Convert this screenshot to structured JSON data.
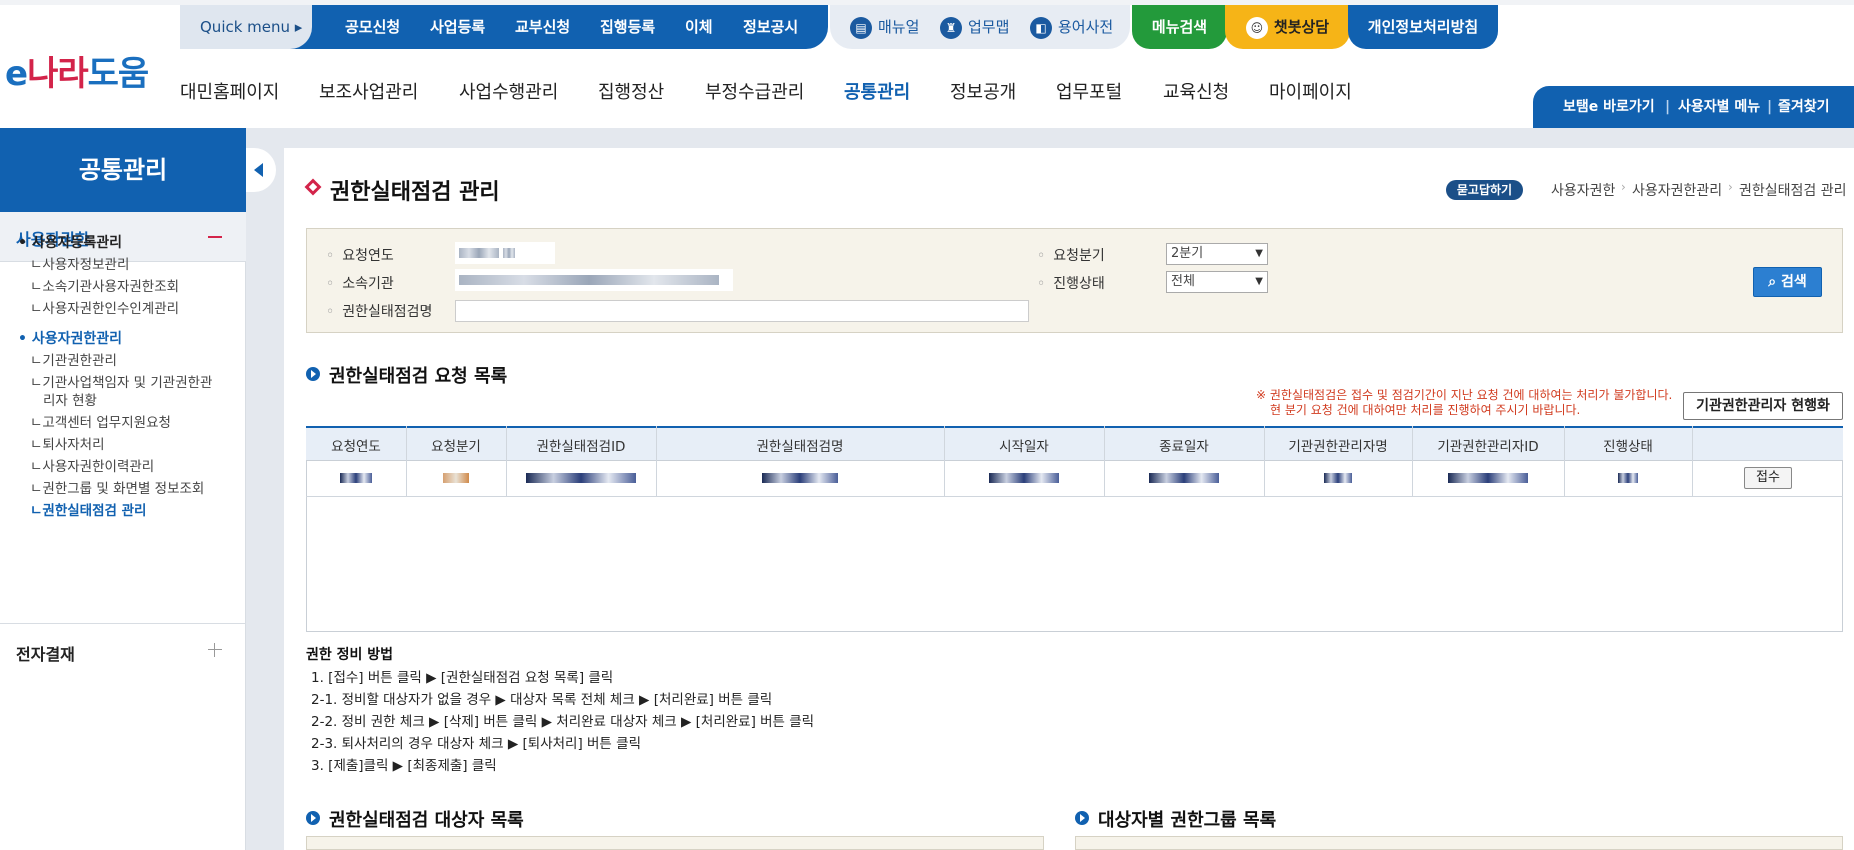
{
  "header": {
    "logo": {
      "e": "e",
      "nara": "나라",
      "doum": "도움"
    },
    "quick_menu": "Quick menu ▸",
    "quick_links": [
      "공모신청",
      "사업등록",
      "교부신청",
      "집행등록",
      "이체",
      "정보공시"
    ],
    "util_links": [
      {
        "icon": "book-icon",
        "glyph": "▤",
        "label": "매뉴얼"
      },
      {
        "icon": "user-map-icon",
        "glyph": "♜",
        "label": "업무맵"
      },
      {
        "icon": "dictionary-icon",
        "glyph": "◧",
        "label": "용어사전"
      }
    ],
    "menu_search": "메뉴검색",
    "chatbot": "챗봇상담",
    "privacy": "개인정보처리방침",
    "gnb": [
      "대민홈페이지",
      "보조사업관리",
      "사업수행관리",
      "집행정산",
      "부정수급관리",
      "공통관리",
      "정보공개",
      "업무포털",
      "교육신청",
      "마이페이지"
    ],
    "gnb_active_index": 5,
    "shortcuts": [
      "보탬e 바로가기",
      "사용자별 메뉴",
      "즐겨찾기"
    ]
  },
  "sidebar": {
    "title": "공통관리",
    "section": "사용자권한",
    "groups": [
      {
        "label": "사용자등록관리",
        "items": [
          "ㄴ사용자정보관리",
          "ㄴ소속기관사용자권한조회",
          "ㄴ사용자권한인수인계관리"
        ]
      },
      {
        "label": "사용자권한관리",
        "items": [
          "ㄴ기관권한관리",
          "ㄴ기관사업책임자 및 기관권한관",
          "리자 현황",
          "ㄴ고객센터 업무지원요청",
          "ㄴ퇴사자처리",
          "ㄴ사용자권한이력관리",
          "ㄴ권한그룹 및 화면별 정보조회",
          "ㄴ권한실태점검 관리"
        ]
      }
    ],
    "section2": "전자결재"
  },
  "main": {
    "title": "권한실태점검 관리",
    "qa_badge": "묻고답하기",
    "breadcrumb": [
      "사용자권한",
      "사용자권한관리",
      "권한실태점검 관리"
    ],
    "search": {
      "year_label": "요청연도",
      "org_label": "소속기관",
      "name_label": "권한실태점검명",
      "quarter_label": "요청분기",
      "quarter_value": "2분기",
      "status_label": "진행상태",
      "status_value": "전체",
      "search_button": "검색"
    },
    "list_title": "권한실태점검 요청 목록",
    "notice": [
      "※ 권한실태점검은 접수 및 점검기간이 지난 요청 건에 대하여는 처리가 불가합니다.",
      "현 분기 요청 건에 대하여만 처리를 진행하여 주시기 바랍니다."
    ],
    "manager_button": "기관권한관리자 현행화",
    "table": {
      "headers": [
        "요청연도",
        "요청분기",
        "권한실태점검ID",
        "권한실태점검명",
        "시작일자",
        "종료일자",
        "기관권한관리자명",
        "기관권한관리자ID",
        "진행상태",
        ""
      ],
      "accept_button": "접수"
    },
    "guide": {
      "title": "권한 정비 방법",
      "lines": [
        "1. [접수] 버튼 클릭 ▶ [권한실태점검 요청 목록] 클릭",
        "2-1. 정비할 대상자가 없을 경우 ▶ 대상자 목록 전체 체크 ▶ [처리완료] 버튼 클릭",
        "2-2. 정비 권한 체크 ▶ [삭제] 버튼 클릭 ▶ 처리완료 대상자 체크 ▶ [처리완료] 버튼 클릭",
        "2-3. 퇴사처리의 경우 대상자 체크 ▶ [퇴사처리] 버튼 클릭",
        "3. [제출]클릭 ▶ [최종제출] 클릭"
      ]
    },
    "target_list_title": "권한실태점검 대상자 목록",
    "group_list_title": "대상자별 권한그룹 목록"
  }
}
